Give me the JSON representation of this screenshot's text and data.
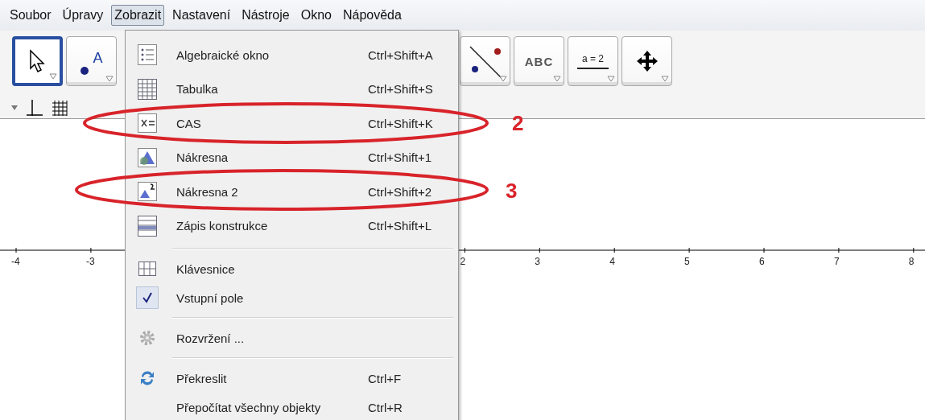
{
  "menubar": [
    {
      "label": "Soubor",
      "selected": false
    },
    {
      "label": "Úpravy",
      "selected": false
    },
    {
      "label": "Zobrazit",
      "selected": true
    },
    {
      "label": "Nastavení",
      "selected": false
    },
    {
      "label": "Nástroje",
      "selected": false
    },
    {
      "label": "Okno",
      "selected": false
    },
    {
      "label": "Nápověda",
      "selected": false
    }
  ],
  "toolbar": [
    {
      "kind": "move",
      "selected": true
    },
    {
      "kind": "point",
      "label": "A",
      "selected": false
    },
    {
      "kind": "line",
      "selected": false
    },
    {
      "kind": "text",
      "label": "ABC",
      "selected": false
    },
    {
      "kind": "slider",
      "label": "a = 2",
      "selected": false
    },
    {
      "kind": "move-view",
      "selected": false
    }
  ],
  "menu": {
    "sections": [
      [
        {
          "label": "Algebraické okno",
          "shortcut": "Ctrl+Shift+A",
          "kind": "algebra"
        },
        {
          "label": "Tabulka",
          "shortcut": "Ctrl+Shift+S",
          "kind": "table"
        },
        {
          "label": "CAS",
          "shortcut": "Ctrl+Shift+K",
          "kind": "cas"
        },
        {
          "label": "Nákresna",
          "shortcut": "Ctrl+Shift+1",
          "kind": "graphics"
        },
        {
          "label": "Nákresna 2",
          "shortcut": "Ctrl+Shift+2",
          "kind": "graphics2"
        },
        {
          "label": "Zápis konstrukce",
          "shortcut": "Ctrl+Shift+L",
          "kind": "construction"
        }
      ],
      [
        {
          "label": "Klávesnice",
          "kind": "keyboard"
        },
        {
          "label": "Vstupní pole",
          "kind": "toggle",
          "checked": true
        }
      ],
      [
        {
          "label": "Rozvržení ...",
          "kind": "gear"
        }
      ],
      [
        {
          "label": "Překreslit",
          "shortcut": "Ctrl+F",
          "kind": "refresh"
        },
        {
          "label": "Přepočítat všechny objekty",
          "shortcut": "Ctrl+R",
          "kind": "plain"
        }
      ]
    ]
  },
  "axis": {
    "ticks": [
      "-4",
      "-3",
      "2",
      "3",
      "4",
      "5",
      "6",
      "7",
      "8"
    ]
  },
  "annotations": [
    {
      "label": "2"
    },
    {
      "label": "3"
    }
  ]
}
